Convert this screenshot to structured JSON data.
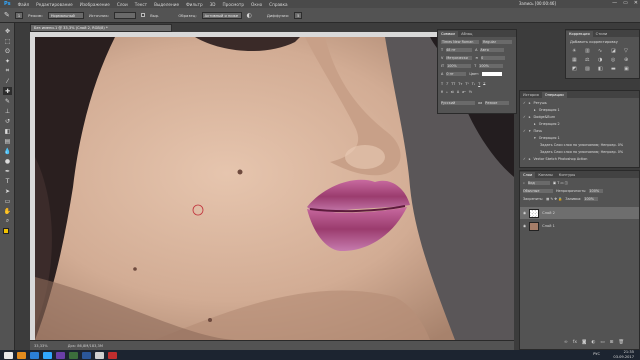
{
  "app": {
    "logo": "Ps",
    "menus": [
      "Файл",
      "Редактирование",
      "Изображение",
      "Слои",
      "Текст",
      "Выделение",
      "Фильтр",
      "3D",
      "Просмотр",
      "Окно",
      "Справка"
    ]
  },
  "recording": "Запись [00:00:46]",
  "options": {
    "size": "1",
    "mode_label": "Режим:",
    "mode": "Нормальный",
    "source_label": "Источник:",
    "sample_label": "Образец:",
    "sample_value": "Активный и ниже",
    "diffusion_label": "Диффузия:",
    "diffusion_value": "5",
    "aligned_label": "Выр."
  },
  "document": {
    "tab": "Без имени-1 @ 33,3% (Слой 2, RGB/8) *"
  },
  "status": {
    "zoom": "33,33%",
    "doc": "Док: 86,8М/183,3М"
  },
  "correction_panel": {
    "tabs": [
      "Коррекция",
      "Стили"
    ],
    "subtitle": "Добавить корректировку"
  },
  "char_panel": {
    "tabs": [
      "Символ",
      "Абзац"
    ],
    "font": "Times New Roman",
    "style": "Regular",
    "size": "48 пт",
    "leading": "Авто",
    "kerning": "Метрически",
    "tracking": "0",
    "scale_v": "100%",
    "scale_h": "100%",
    "baseline": "0 пт",
    "color_label": "Цвет:",
    "lang": "Русский",
    "aa": "Резкое"
  },
  "history_panel": {
    "tabs": [
      "История",
      "Операции"
    ],
    "items": [
      "Ретушь",
      "Операция 1",
      "Dodge&Burn",
      "Операция 2",
      "Пачь",
      "Операция 1",
      "Задать Слои слоя по умолчанию; Непрозр. 0%",
      "Задать Слои слоя по умолчанию; Непрозр. 0%",
      "Vector Sketch Photoshop Action"
    ]
  },
  "layers_panel": {
    "tabs": [
      "Слои",
      "Каналы",
      "Контуры"
    ],
    "kind_label": "Вид",
    "blend": "Обычные",
    "opacity_label": "Непрозрачность:",
    "opacity": "100%",
    "lock_label": "Закрепить:",
    "fill_label": "Заливка:",
    "fill": "100%",
    "layers": [
      "Слой 2",
      "Слой 1"
    ]
  },
  "taskbar": {
    "lang": "РУС",
    "time": "21:35",
    "date": "03.09.2017"
  },
  "colors": {
    "accent": "#31a8ff",
    "panel": "#535353",
    "skin": "#d9b9a3",
    "lips": "#b24e86"
  }
}
